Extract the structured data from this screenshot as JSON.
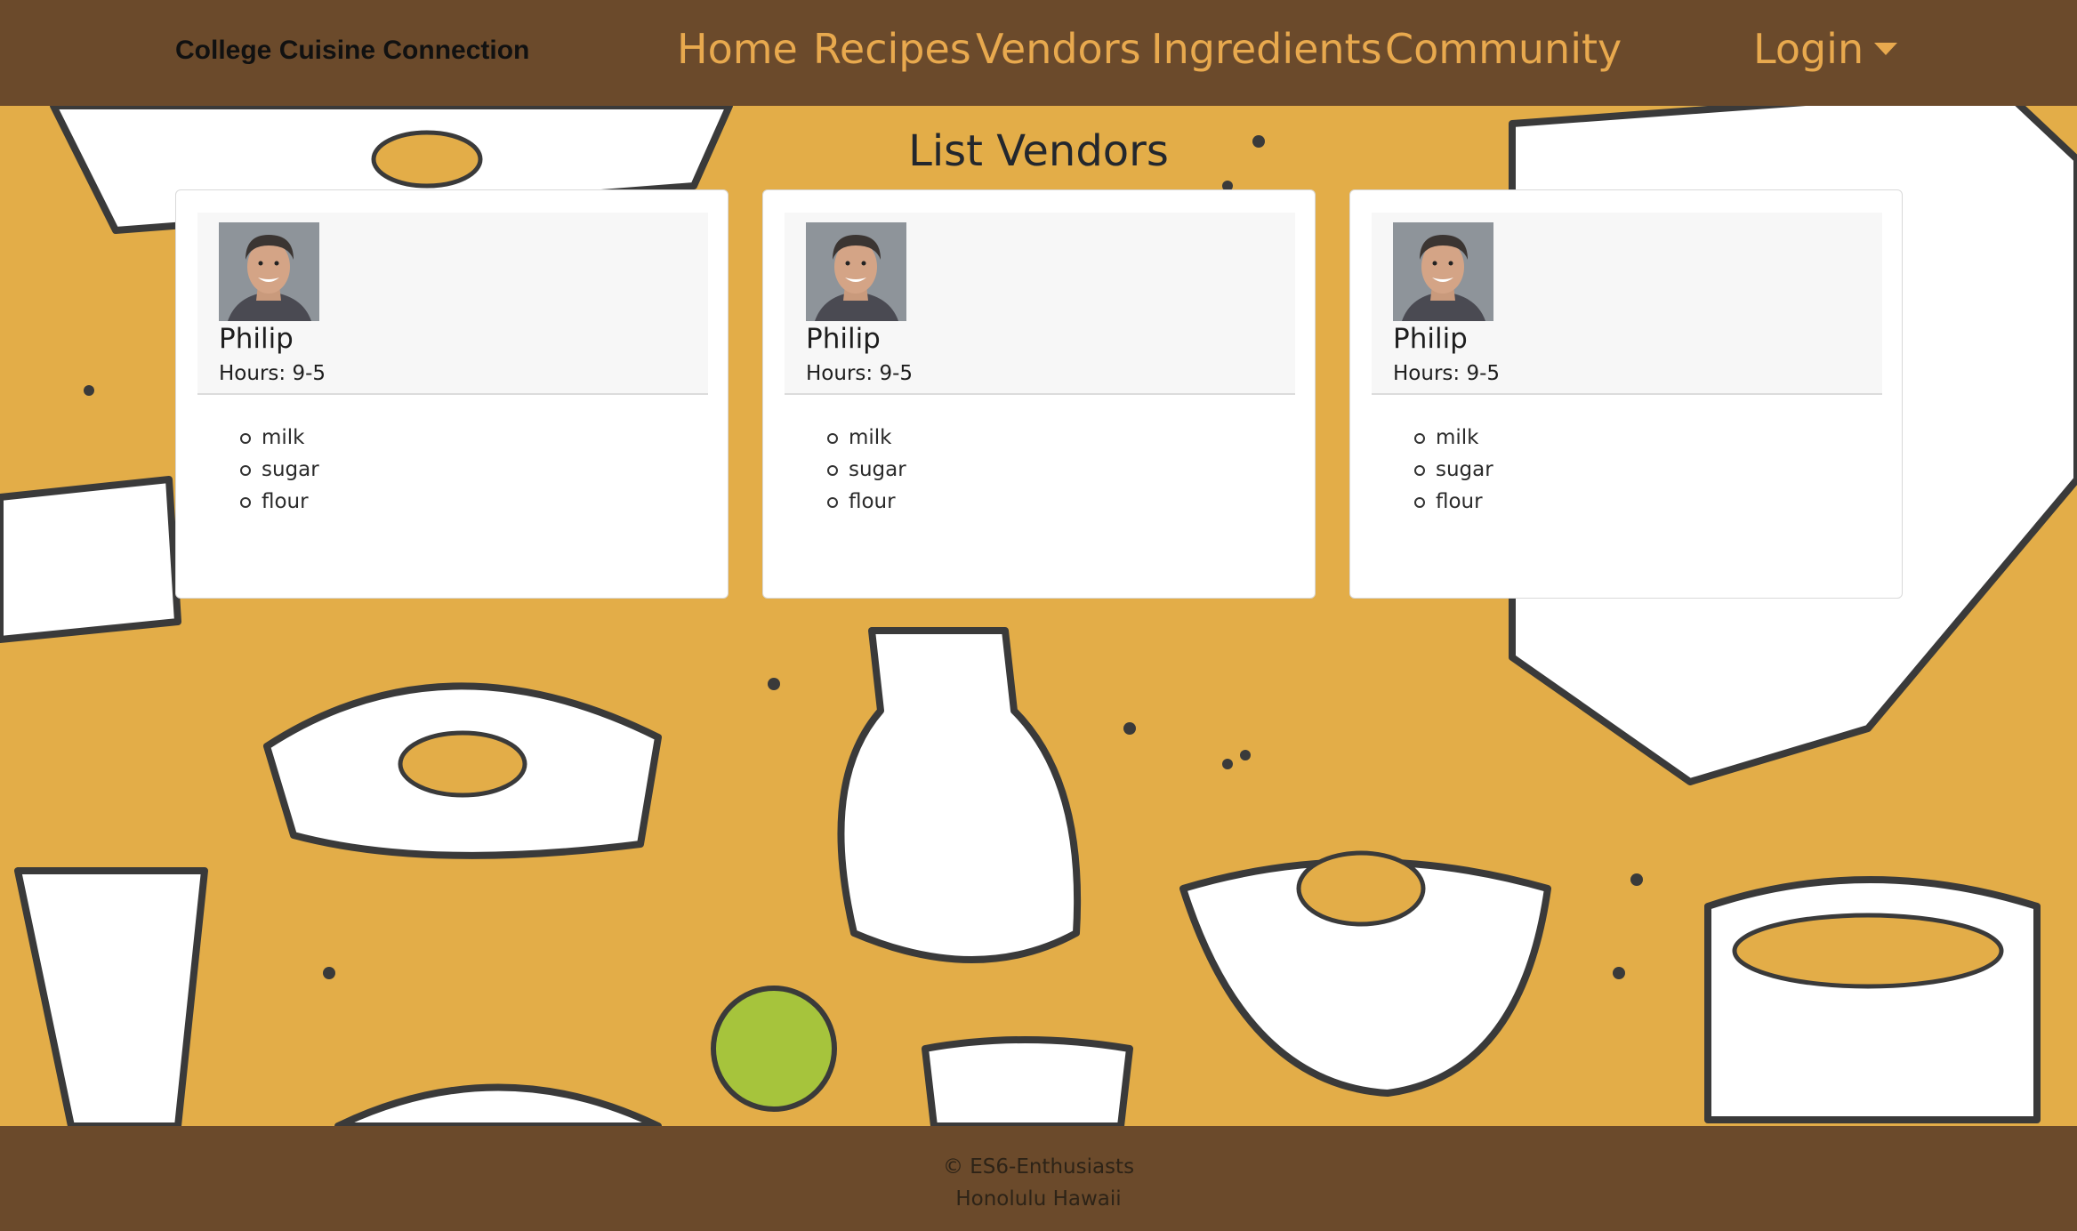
{
  "navbar": {
    "brand": "College Cuisine Connection",
    "links": [
      "Home",
      "Recipes",
      "Vendors",
      "Ingredients",
      "Community"
    ],
    "login_label": "Login"
  },
  "main": {
    "heading": "List Vendors",
    "vendors": [
      {
        "name": "Philip",
        "hours": "Hours: 9-5",
        "ingredients": [
          "milk",
          "sugar",
          "flour"
        ]
      },
      {
        "name": "Philip",
        "hours": "Hours: 9-5",
        "ingredients": [
          "milk",
          "sugar",
          "flour"
        ]
      },
      {
        "name": "Philip",
        "hours": "Hours: 9-5",
        "ingredients": [
          "milk",
          "sugar",
          "flour"
        ]
      }
    ]
  },
  "footer": {
    "line1": "© ES6-Enthusiasts",
    "line2": "Honolulu Hawaii"
  },
  "colors": {
    "navbar_bg": "#6b4a2b",
    "nav_link": "#e8a94e",
    "page_bg": "#e3ad48"
  },
  "icons": {
    "login_caret": "caret-down-icon"
  }
}
